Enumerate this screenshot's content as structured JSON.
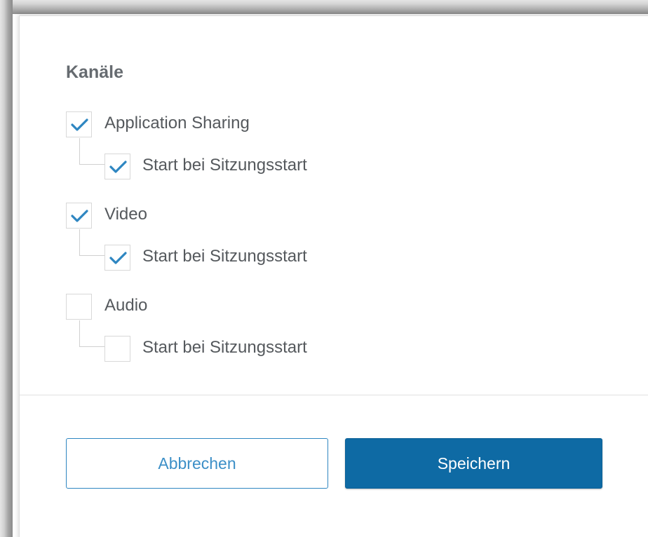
{
  "channels": {
    "title": "Kanäle",
    "items": [
      {
        "label": "Application Sharing",
        "checked": true,
        "sub": {
          "label": "Start bei Sitzungsstart",
          "checked": true
        }
      },
      {
        "label": "Video",
        "checked": true,
        "sub": {
          "label": "Start bei Sitzungsstart",
          "checked": true
        }
      },
      {
        "label": "Audio",
        "checked": false,
        "sub": {
          "label": "Start bei Sitzungsstart",
          "checked": false
        }
      }
    ]
  },
  "actions": {
    "cancel_label": "Abbrechen",
    "save_label": "Speichern"
  },
  "colors": {
    "checkmark": "#2e86c1",
    "primary": "#0e6aa4",
    "title_text": "#666b70",
    "label_text": "#55595d"
  },
  "icons": {
    "checked": "checkmark-icon"
  }
}
